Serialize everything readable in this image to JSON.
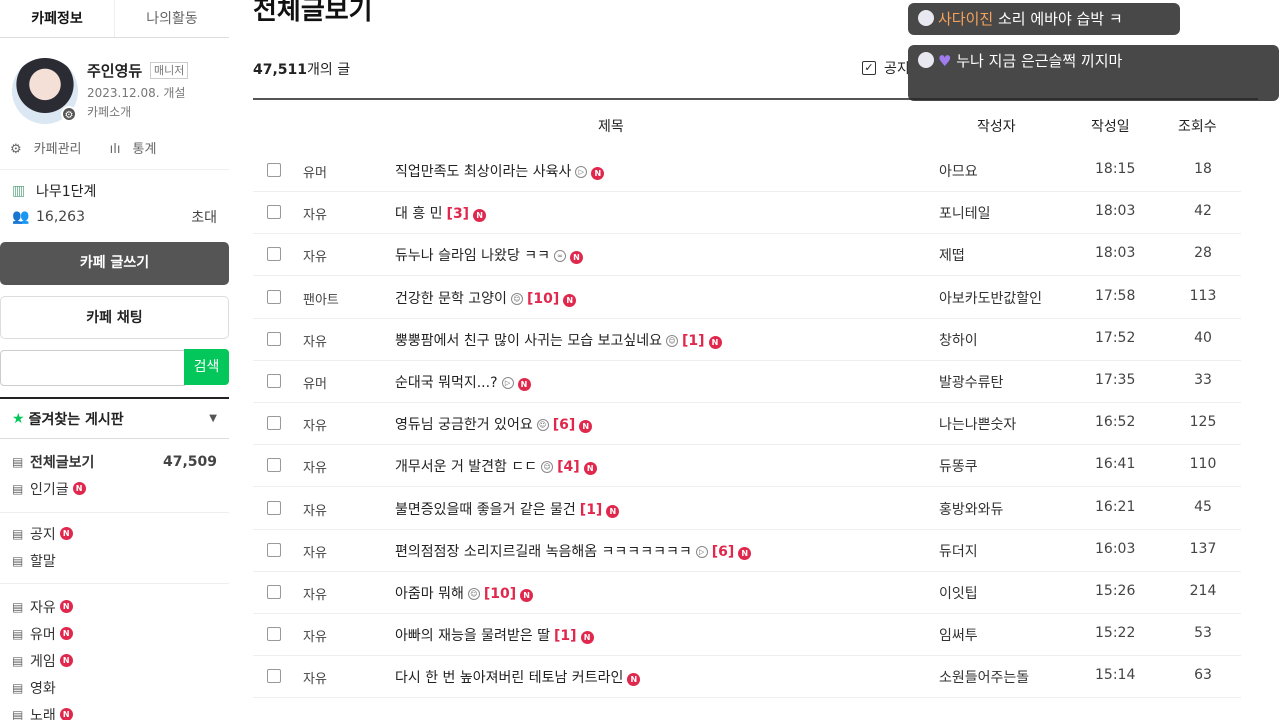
{
  "sidebar": {
    "tabs": [
      "카페정보",
      "나의활동"
    ],
    "manager_name": "주인영듀",
    "manager_badge": "매니저",
    "open_date": "2023.12.08. 개설",
    "cafe_intro": "카페소개",
    "manage_link": "카페관리",
    "stats_link": "통계",
    "level": "나무1단계",
    "member_count": "16,263",
    "invite": "초대",
    "write_button": "카페 글쓰기",
    "chat_button": "카페 채팅",
    "search_button": "검색",
    "favorites_label": "즐겨찾는 게시판",
    "menu1": [
      {
        "label": "전체글보기",
        "count": "47,509",
        "bold": true,
        "new": false
      },
      {
        "label": "인기글",
        "count": "",
        "bold": false,
        "new": true
      }
    ],
    "menu2": [
      {
        "label": "공지",
        "new": true
      },
      {
        "label": "할말",
        "new": false
      }
    ],
    "menu3": [
      {
        "label": "자유",
        "new": true
      },
      {
        "label": "유머",
        "new": true
      },
      {
        "label": "게임",
        "new": true
      },
      {
        "label": "영화",
        "new": false
      },
      {
        "label": "노래",
        "new": true
      }
    ]
  },
  "main": {
    "title": "전체글보기",
    "post_count": "47,511",
    "post_count_suffix": "개의 글",
    "notice_label": "공지",
    "headers": {
      "title": "제목",
      "author": "작성자",
      "date": "작성일",
      "views": "조회수"
    },
    "posts": [
      {
        "cat": "유머",
        "title": "직업만족도 최상이라는 사육사",
        "icon": "video",
        "comments": "",
        "author": "아므요",
        "date": "18:15",
        "views": "18"
      },
      {
        "cat": "자유",
        "title": "대 흥 민",
        "icon": "",
        "comments": "[3]",
        "author": "포니테일",
        "date": "18:03",
        "views": "42"
      },
      {
        "cat": "자유",
        "title": "듀누나 슬라임 나왔당 ㅋㅋ",
        "icon": "link",
        "comments": "",
        "author": "제떱",
        "date": "18:03",
        "views": "28"
      },
      {
        "cat": "팬아트",
        "title": "건강한 문학 고양이",
        "icon": "image",
        "comments": "[10]",
        "author": "아보카도반값할인",
        "date": "17:58",
        "views": "113"
      },
      {
        "cat": "자유",
        "title": "뿡뿡팜에서 친구 많이 사귀는 모습 보고싶네요",
        "icon": "image",
        "comments": "[1]",
        "author": "창하이",
        "date": "17:52",
        "views": "40"
      },
      {
        "cat": "유머",
        "title": "순대국 뭐먹지...?",
        "icon": "video",
        "comments": "",
        "author": "발광수류탄",
        "date": "17:35",
        "views": "33"
      },
      {
        "cat": "자유",
        "title": "영듀님 궁금한거 있어요",
        "icon": "image",
        "comments": "[6]",
        "author": "나는나쁜숫자",
        "date": "16:52",
        "views": "125"
      },
      {
        "cat": "자유",
        "title": "개무서운 거 발견함 ㄷㄷ",
        "icon": "image",
        "comments": "[4]",
        "author": "듀똥쿠",
        "date": "16:41",
        "views": "110"
      },
      {
        "cat": "자유",
        "title": "불면증있을때 좋을거 같은 물건",
        "icon": "",
        "comments": "[1]",
        "author": "홍방와와듀",
        "date": "16:21",
        "views": "45"
      },
      {
        "cat": "자유",
        "title": "편의점점장 소리지르길래 녹음해옴 ㅋㅋㅋㅋㅋㅋㅋ",
        "icon": "video",
        "comments": "[6]",
        "author": "듀더지",
        "date": "16:03",
        "views": "137"
      },
      {
        "cat": "자유",
        "title": "아줌마 뭐해",
        "icon": "image",
        "comments": "[10]",
        "author": "이잇팁",
        "date": "15:26",
        "views": "214"
      },
      {
        "cat": "자유",
        "title": "아빠의 재능을 물려받은 딸",
        "icon": "",
        "comments": "[1]",
        "author": "임써투",
        "date": "15:22",
        "views": "53"
      },
      {
        "cat": "자유",
        "title": "다시 한 번 높아져버린 테토남 커트라인",
        "icon": "",
        "comments": "",
        "author": "소원들어주는돌",
        "date": "15:14",
        "views": "63"
      }
    ]
  },
  "overlay": {
    "chat1_nick": "사다이진",
    "chat1_text": " 소리 에바야 습박 ㅋ",
    "chat2_text": "누나 지금 은근슬쩍 끼지마"
  },
  "colors": {
    "accent_green": "#03c75a",
    "new_badge": "#e0284d",
    "write_button": "#555555"
  }
}
